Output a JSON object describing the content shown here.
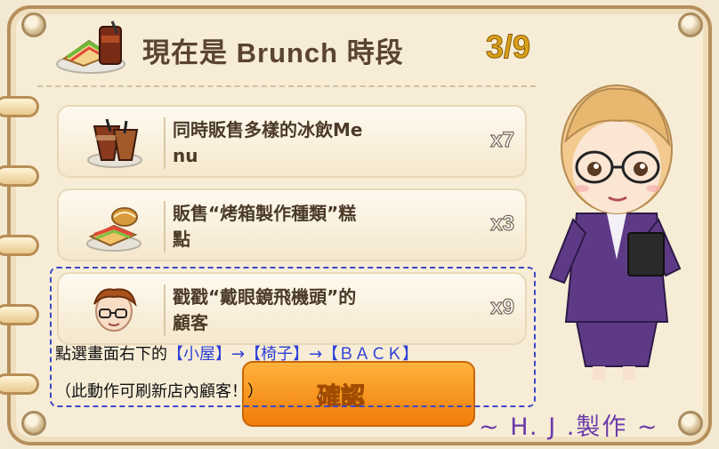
{
  "header": {
    "title": "現在是 Brunch 時段",
    "progress": "3/9",
    "icon": "brunch-sandwich-drink-icon"
  },
  "tasks": [
    {
      "text_line1": "同時販售多樣的冰飲Me",
      "text_line2": "nu",
      "count": "x7",
      "icon": "iced-drinks-icon"
    },
    {
      "text_line1": "販售“烤箱製作種類”糕",
      "text_line2": "點",
      "count": "x3",
      "icon": "baked-pastry-icon"
    },
    {
      "text_line1": "戳戳“戴眼鏡飛機頭”的",
      "text_line2": "顧客",
      "count": "x9",
      "icon": "customer-glasses-avatar-icon"
    }
  ],
  "confirm_label": "確認",
  "annotation": {
    "line1_prefix": "點選畫面右下的",
    "line1_highlight": "【小屋】→【椅子】→【ＢＡＣＫ】",
    "line2": "（此動作可刷新店內顧客！）"
  },
  "credit": "~ H. J .製作 ~",
  "colors": {
    "progress": "#d8a11a",
    "button": "#f08a14",
    "highlight_border": "#3d47c8",
    "credit": "#6a3aa8"
  }
}
